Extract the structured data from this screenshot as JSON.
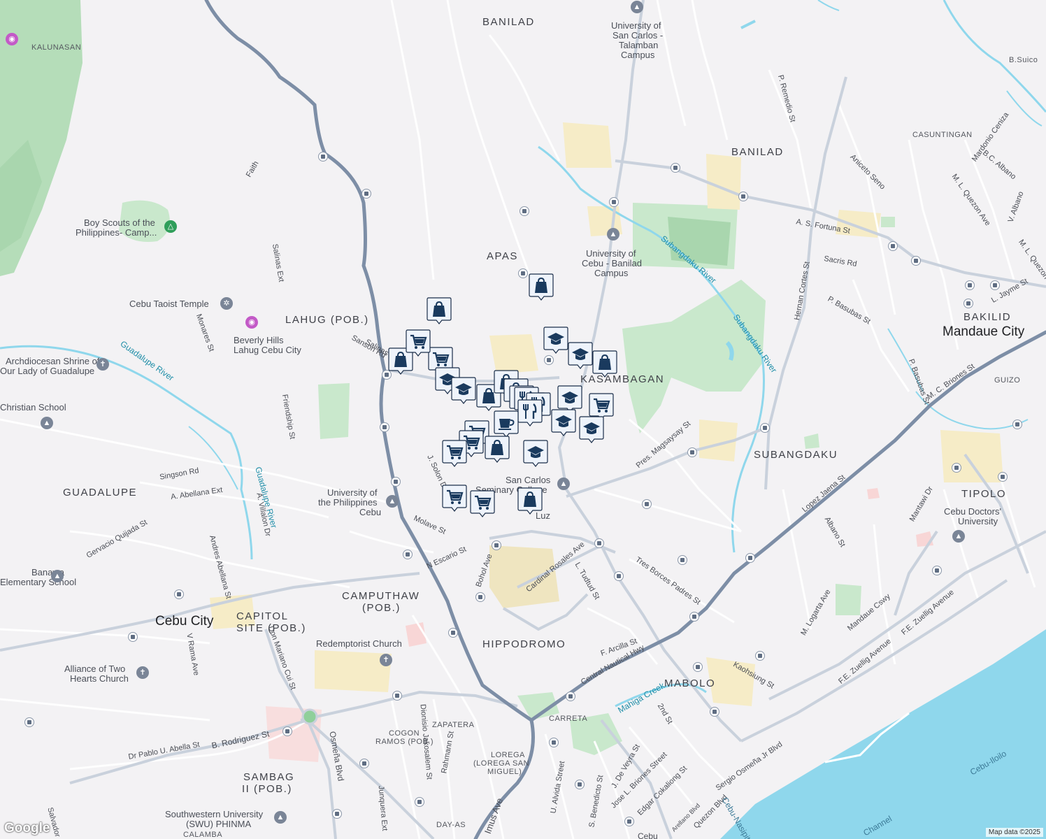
{
  "attribution": "Map data ©2025",
  "logo": "Google",
  "colors": {
    "background": "#f3f2f4",
    "road": "#ffffff",
    "arterial": "#c9d1dc",
    "highway": "#7d8ea6",
    "water": "#8fd7ec",
    "park": "#c9e8cc",
    "forest": "#b5ddb9",
    "campus": "#f6ecc7",
    "marker": "#1a3a5e",
    "marker_fill": "#eef3fb"
  },
  "areas": [
    {
      "text": "BANILAD"
    },
    {
      "text": "BANILAD"
    },
    {
      "text": "APAS"
    },
    {
      "text": "LAHUG (POB.)"
    },
    {
      "text": "KASAMBAGAN"
    },
    {
      "text": "SUBANGDAKU"
    },
    {
      "text": "TIPOLO"
    },
    {
      "text": "BAKILID"
    },
    {
      "text": "GUADALUPE"
    },
    {
      "text": "CAMPUTHAW"
    },
    {
      "text": "(POB.)"
    },
    {
      "text": "CAPITOL"
    },
    {
      "text": "SITE (POB.)"
    },
    {
      "text": "HIPPODROMO"
    },
    {
      "text": "MABOLO"
    },
    {
      "text": "SAMBAG"
    },
    {
      "text": "II (POB.)"
    }
  ],
  "cities": [
    {
      "text": "Mandaue City"
    },
    {
      "text": "Cebu City"
    }
  ],
  "small_areas": [
    {
      "text": "KALUNASAN"
    },
    {
      "text": "CASUNTINGAN"
    },
    {
      "text": "GUIZO"
    },
    {
      "text": "ZAPATERA"
    },
    {
      "text": "COGON"
    },
    {
      "text": "RAMOS (POB.)"
    },
    {
      "text": "LOREGA"
    },
    {
      "text": "(LOREGA SAN"
    },
    {
      "text": "MIGUEL)"
    },
    {
      "text": "CARRETA"
    },
    {
      "text": "DAY-AS"
    },
    {
      "text": "CALAMBA"
    },
    {
      "text": "B.Suico"
    }
  ],
  "pois": [
    {
      "text": "University of"
    },
    {
      "text": "San Carlos -"
    },
    {
      "text": "Talamban"
    },
    {
      "text": "Campus"
    },
    {
      "text": "University of"
    },
    {
      "text": "Cebu - Banilad"
    },
    {
      "text": "Campus"
    },
    {
      "text": "Boy Scouts of the"
    },
    {
      "text": "Philippines- Camp..."
    },
    {
      "text": "Cebu Taoist Temple"
    },
    {
      "text": "Beverly Hills"
    },
    {
      "text": "Lahug Cebu City"
    },
    {
      "text": "Archdiocesan Shrine of"
    },
    {
      "text": "Our Lady of Guadalupe"
    },
    {
      "text": "Christian School"
    },
    {
      "text": "University of"
    },
    {
      "text": "the Philippines"
    },
    {
      "text": "Cebu"
    },
    {
      "text": "San Carlos"
    },
    {
      "text": "Seminary College"
    },
    {
      "text": "Luz"
    },
    {
      "text": "Banawa"
    },
    {
      "text": "Elementary School"
    },
    {
      "text": "Redemptorist Church"
    },
    {
      "text": "Alliance of Two"
    },
    {
      "text": "Hearts Church"
    },
    {
      "text": "Cebu Doctors'"
    },
    {
      "text": "University"
    },
    {
      "text": "Southwestern University"
    },
    {
      "text": "(SWU) PHINMA"
    }
  ],
  "streets": [
    {
      "text": "Faith"
    },
    {
      "text": "Salinas Ext"
    },
    {
      "text": "Monares St"
    },
    {
      "text": "Salinas Dr"
    },
    {
      "text": "Sanson Rd"
    },
    {
      "text": "Friendship St"
    },
    {
      "text": "Singson Rd"
    },
    {
      "text": "A. Abellana Ext"
    },
    {
      "text": "A. Villalon Dr"
    },
    {
      "text": "Gervacio Quijada St"
    },
    {
      "text": "Andres Abellana St"
    },
    {
      "text": "J. Solon Dr"
    },
    {
      "text": "Molave St"
    },
    {
      "text": "N Escario St"
    },
    {
      "text": "Bohol Ave"
    },
    {
      "text": "Cardinal Rosales Ave"
    },
    {
      "text": "L. Tudtud St"
    },
    {
      "text": "Tres Borces Padres St"
    },
    {
      "text": "F. Arcilla St"
    },
    {
      "text": "Central Nautical Hwy"
    },
    {
      "text": "Pres. Magsaysay St"
    },
    {
      "text": "Lopez Jaena St"
    },
    {
      "text": "Albano St"
    },
    {
      "text": "M. Logarta Ave"
    },
    {
      "text": "Mandaue Cswy"
    },
    {
      "text": "F.E. Zuellig Avenue"
    },
    {
      "text": "F.E. Zuellig Avenue"
    },
    {
      "text": "Mantawi Dr"
    },
    {
      "text": "Hernan Cortes St"
    },
    {
      "text": "A. S. Fortuna St"
    },
    {
      "text": "Sacris Rd"
    },
    {
      "text": "P. Basubas St"
    },
    {
      "text": "P. Basubas St"
    },
    {
      "text": "M. C. Briones St"
    },
    {
      "text": "M. L. Quezon Ave"
    },
    {
      "text": "M. L. Quezon"
    },
    {
      "text": "L. Jayme St"
    },
    {
      "text": "V. Albano"
    },
    {
      "text": "B.C. Albano"
    },
    {
      "text": "Mardonio Ceniza"
    },
    {
      "text": "Aniceto Seno"
    },
    {
      "text": "P. Remedio St"
    },
    {
      "text": "Kaohsiung St"
    },
    {
      "text": "2nd St"
    },
    {
      "text": "J. De Veyra St"
    },
    {
      "text": "Jose L. Briones Street"
    },
    {
      "text": "Edgar Cokaliong St"
    },
    {
      "text": "Sergio Osmeña Jr Blvd"
    },
    {
      "text": "Quezon Blvd"
    },
    {
      "text": "Arellano Blvd"
    },
    {
      "text": "U. Alvida Street"
    },
    {
      "text": "S. Benedicto St"
    },
    {
      "text": "Imus Ave"
    },
    {
      "text": "Rahmann St"
    },
    {
      "text": "Dionisio Jakosalem St"
    },
    {
      "text": "Junquera Ext"
    },
    {
      "text": "Osmeña Blvd"
    },
    {
      "text": "Don Mariano Cui St"
    },
    {
      "text": "B. Rodriguez St"
    },
    {
      "text": "Dr Pablo U. Abella St"
    },
    {
      "text": "V Rama Ave"
    },
    {
      "text": "Salvador"
    },
    {
      "text": "Cebu"
    }
  ],
  "waters": [
    {
      "text": "Guadalupe River"
    },
    {
      "text": "Guadalupe River"
    },
    {
      "text": "Subangdaku River"
    },
    {
      "text": "Subangdaku River"
    },
    {
      "text": "Mahiga Creek"
    },
    {
      "text": "Cebu-Iloilo"
    },
    {
      "text": "Cebu-Nasipit"
    },
    {
      "text": "Channel"
    }
  ],
  "markers": [
    {
      "icon": "shopping-bag"
    },
    {
      "icon": "shopping-bag"
    },
    {
      "icon": "shopping-cart"
    },
    {
      "icon": "shopping-bag"
    },
    {
      "icon": "shopping-cart"
    },
    {
      "icon": "graduation-cap"
    },
    {
      "icon": "graduation-cap"
    },
    {
      "icon": "shopping-bag"
    },
    {
      "icon": "graduation-cap"
    },
    {
      "icon": "shopping-bag"
    },
    {
      "icon": "shopping-bag"
    },
    {
      "icon": "shopping-bag"
    },
    {
      "icon": "shopping-bag"
    },
    {
      "icon": "restaurant"
    },
    {
      "icon": "restaurant"
    },
    {
      "icon": "restaurant"
    },
    {
      "icon": "graduation-cap"
    },
    {
      "icon": "shopping-cart"
    },
    {
      "icon": "graduation-cap"
    },
    {
      "icon": "graduation-cap"
    },
    {
      "icon": "coffee"
    },
    {
      "icon": "shopping-cart"
    },
    {
      "icon": "shopping-cart"
    },
    {
      "icon": "shopping-cart"
    },
    {
      "icon": "shopping-bag"
    },
    {
      "icon": "graduation-cap"
    },
    {
      "icon": "shopping-cart"
    },
    {
      "icon": "shopping-cart"
    },
    {
      "icon": "shopping-bag"
    }
  ]
}
